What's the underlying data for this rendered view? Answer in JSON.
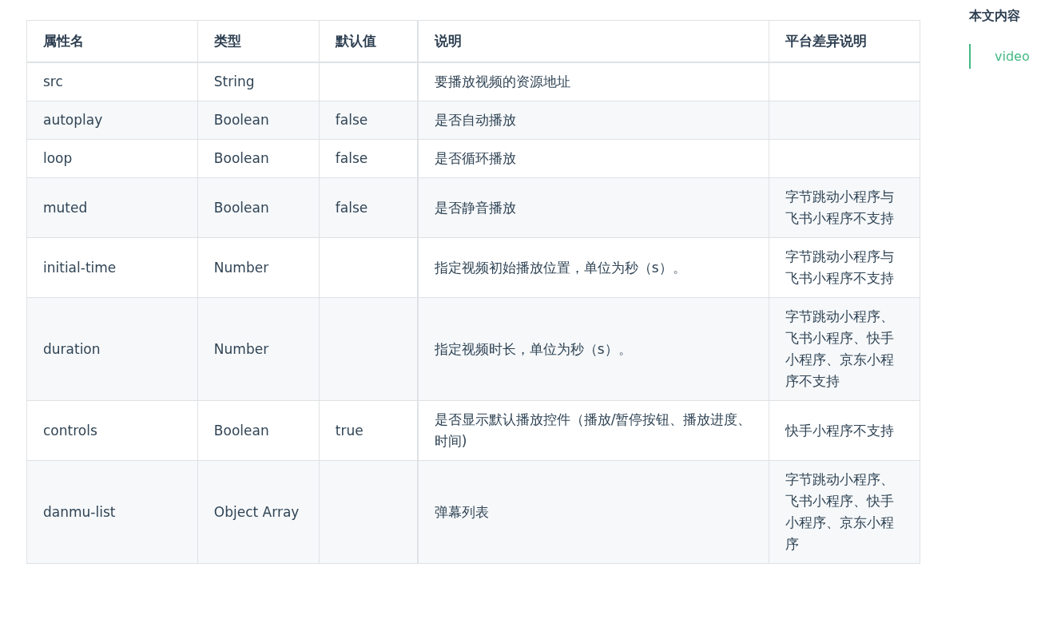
{
  "table": {
    "columns": [
      "属性名",
      "类型",
      "默认值",
      "说明",
      "平台差异说明"
    ],
    "rows": [
      {
        "name": "src",
        "type": "String",
        "description": "要播放视频的资源地址"
      },
      {
        "name": "autoplay",
        "type": "Boolean",
        "default": "false",
        "description": "是否自动播放"
      },
      {
        "name": "loop",
        "type": "Boolean",
        "default": "false",
        "description": "是否循环播放"
      },
      {
        "name": "muted",
        "type": "Boolean",
        "default": "false",
        "description": "是否静音播放",
        "platform_notes": "字节跳动小程序与飞书小程序不支持"
      },
      {
        "name": "initial-time",
        "type": "Number",
        "description": "指定视频初始播放位置，单位为秒（s）。",
        "platform_notes": "字节跳动小程序与飞书小程序不支持"
      },
      {
        "name": "duration",
        "type": "Number",
        "description": "指定视频时长，单位为秒（s）。",
        "platform_notes": "字节跳动小程序、飞书小程序、快手小程序、京东小程序不支持"
      },
      {
        "name": "controls",
        "type": "Boolean",
        "default": "true",
        "description": "是否显示默认播放控件（播放/暂停按钮、播放进度、时间)",
        "platform_notes": "快手小程序不支持"
      },
      {
        "name": "danmu-list",
        "type": "Object Array",
        "description": "弹幕列表",
        "platform_notes": "字节跳动小程序、飞书小程序、快手小程序、京东小程序"
      }
    ]
  },
  "toc": {
    "title": "本文内容",
    "items": [
      {
        "label": "video",
        "selected": true
      }
    ]
  }
}
